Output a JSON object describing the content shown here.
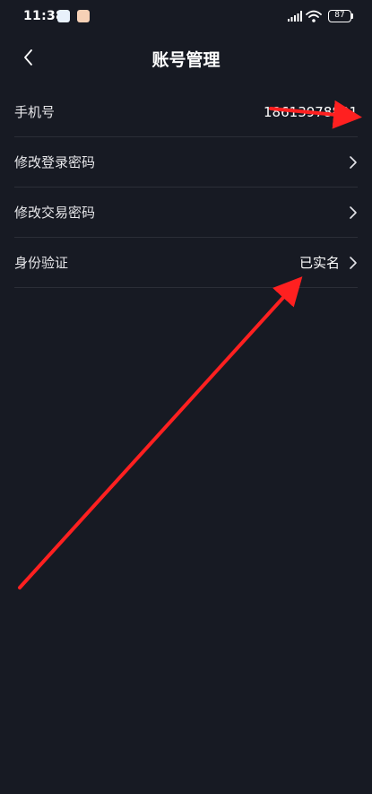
{
  "status_bar": {
    "time": "11:38",
    "battery": "87",
    "icons": [
      "blue-app-icon",
      "red-app-icon",
      "signal-icon",
      "wifi-icon",
      "battery-icon"
    ]
  },
  "header": {
    "title": "账号管理",
    "back_icon": "chevron-left-icon"
  },
  "settings": {
    "items": [
      {
        "label": "手机号",
        "value": "18613978831",
        "has_chevron": false
      },
      {
        "label": "修改登录密码",
        "value": "",
        "has_chevron": true
      },
      {
        "label": "修改交易密码",
        "value": "",
        "has_chevron": true
      },
      {
        "label": "身份验证",
        "value": "已实名",
        "has_chevron": true
      }
    ]
  },
  "colors": {
    "background": "#171a23",
    "divider": "#2b2e37",
    "text": "#ffffff",
    "annotation": "#ff2020"
  }
}
